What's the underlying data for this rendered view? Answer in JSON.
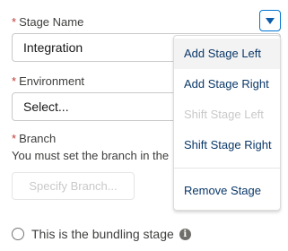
{
  "form": {
    "stage_name": {
      "required_marker": "*",
      "label": "Stage Name",
      "value": "Integration"
    },
    "environment": {
      "required_marker": "*",
      "label": "Environment",
      "placeholder": "Select..."
    },
    "branch": {
      "required_marker": "*",
      "label": "Branch",
      "help_text": "You must set the branch in the",
      "button_label": "Specify Branch..."
    },
    "bundling": {
      "label": "This is the bundling stage",
      "icon": "info-icon"
    }
  },
  "menu": {
    "trigger_icon": "chevron-down-icon",
    "items": [
      {
        "label": "Add Stage Left",
        "state": "active"
      },
      {
        "label": "Add Stage Right",
        "state": "enabled"
      },
      {
        "label": "Shift Stage Left",
        "state": "disabled"
      },
      {
        "label": "Shift Stage Right",
        "state": "enabled"
      },
      {
        "label": "Remove Stage",
        "state": "enabled"
      }
    ]
  },
  "colors": {
    "required": "#c23934",
    "menu_text": "#0b3869",
    "menu_disabled": "#c9c9c9",
    "accent": "#0176d3"
  }
}
